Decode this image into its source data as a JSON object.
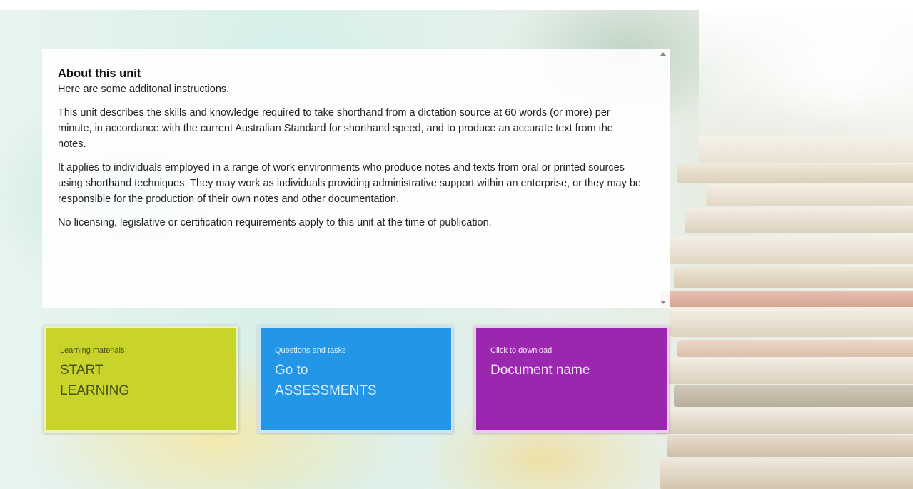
{
  "about": {
    "title": "About this unit",
    "intro": "Here are some additonal instructions.",
    "paragraphs": [
      "This unit describes the skills and knowledge required to take shorthand from a dictation source at 60 words (or more) per minute, in accordance with the current Australian Standard for shorthand speed, and to produce an accurate text from the notes.",
      "It applies to individuals employed in a range of work environments who produce notes and texts from oral or printed sources using shorthand techniques. They may work as individuals providing administrative support within an enterprise, or they may be responsible for the production of their own notes and other documentation.",
      "No licensing, legislative or certification requirements apply to this unit at the time of publication."
    ]
  },
  "tiles": {
    "learning": {
      "subtitle": "Learning materials",
      "label": "START\nLEARNING",
      "color": "#c8d42a"
    },
    "assessments": {
      "subtitle": "Questions and tasks",
      "label": "Go to\nASSESSMENTS",
      "color": "#2396e8"
    },
    "download": {
      "subtitle": "Click to download",
      "label": "Document name",
      "color": "#9b27af"
    }
  }
}
